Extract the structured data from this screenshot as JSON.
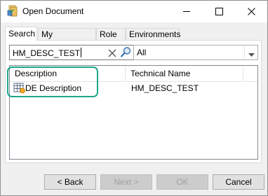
{
  "window": {
    "title": "Open Document"
  },
  "tabs": [
    {
      "label": "Search"
    },
    {
      "label": "My Documents"
    },
    {
      "label": "Role"
    },
    {
      "label": "Environments"
    }
  ],
  "search": {
    "value": "HM_DESC_TEST"
  },
  "filter": {
    "selected": "All"
  },
  "table": {
    "columns": [
      "Description",
      "Technical Name"
    ],
    "rows": [
      {
        "description": "DE Description",
        "technical_name": "HM_DESC_TEST"
      }
    ]
  },
  "buttons": {
    "back": "< Back",
    "next": "Next >",
    "ok": "OK",
    "cancel": "Cancel"
  },
  "colors": {
    "highlight": "#1ea889"
  }
}
